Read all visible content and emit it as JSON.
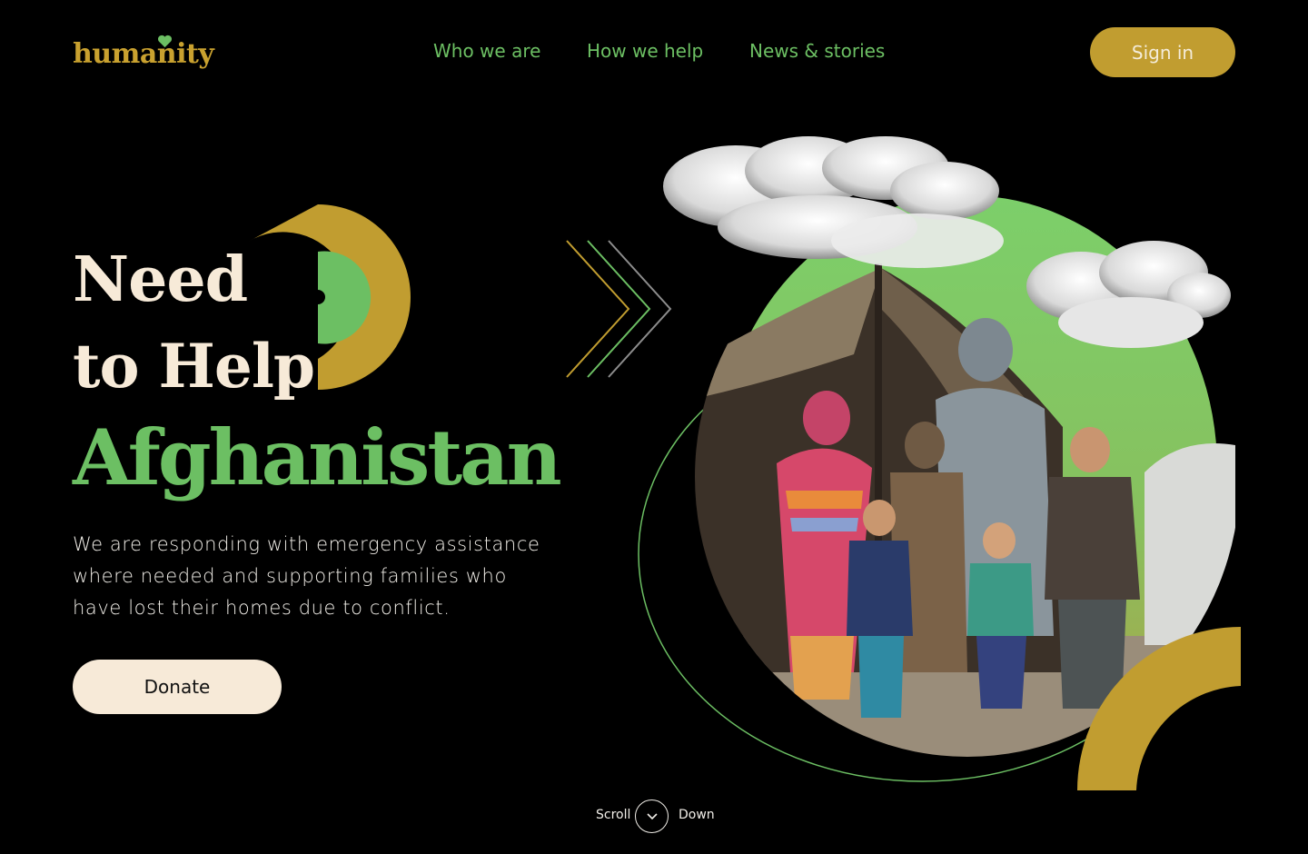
{
  "brand": {
    "name": "humanity",
    "color": "#c9a12f",
    "heart_icon": "heart-icon",
    "heart_color": "#6cbf63"
  },
  "nav": {
    "items": [
      {
        "label": "Who we are"
      },
      {
        "label": "How we help"
      },
      {
        "label": "News & stories"
      }
    ],
    "signin_label": "Sign in"
  },
  "hero": {
    "line1": "Need",
    "line2": "to Help",
    "line3": "Afghanistan",
    "description": "We are responding with emergency assistance where needed and supporting families who have lost their homes due to conflict.",
    "donate_label": "Donate",
    "image_alt": "Afghan family standing in front of a tent"
  },
  "scroll": {
    "left_label": "Scroll",
    "right_label": "Down",
    "icon": "chevron-down-icon"
  },
  "colors": {
    "background": "#000000",
    "accent_gold": "#c19d30",
    "accent_green": "#6cbf63",
    "cream": "#f7ead8"
  }
}
